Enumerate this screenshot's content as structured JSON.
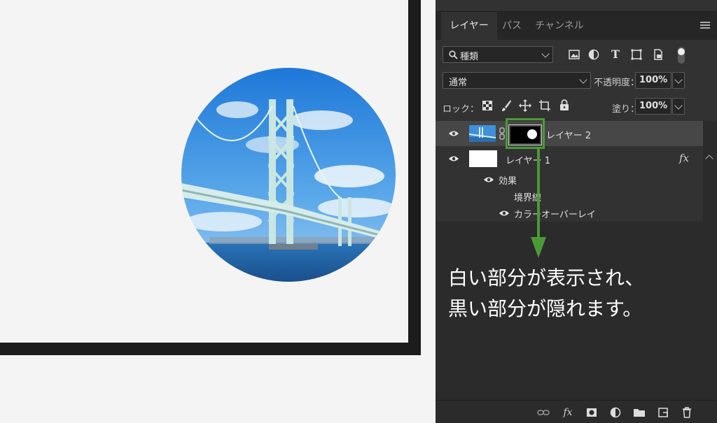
{
  "tabs": [
    {
      "label": "レイヤー"
    },
    {
      "label": "パス"
    },
    {
      "label": "チャンネル"
    }
  ],
  "filter": {
    "kind_label": "種類"
  },
  "blend": {
    "mode": "通常",
    "opacity_label": "不透明度：",
    "opacity_value": "100%"
  },
  "lock": {
    "label": "ロック：",
    "fill_label": "塗り：",
    "fill_value": "100%"
  },
  "layers": [
    {
      "name": "レイヤー 2",
      "selected": true
    },
    {
      "name": "レイヤー 1",
      "fx_badge": "fx"
    }
  ],
  "effects": {
    "header": "効果",
    "items": [
      "境界線",
      "カラーオーバーレイ"
    ]
  },
  "annotation": {
    "line1": "白い部分が表示され、",
    "line2": "黒い部分が隠れます。"
  },
  "colors": {
    "annotation_green": "#4a9a36",
    "panel_bg": "#323232",
    "selected_row": "#474747"
  },
  "icons": [
    "eye-icon",
    "search-icon",
    "image-filter-icon",
    "adjustment-filter-icon",
    "type-filter-icon",
    "shape-filter-icon",
    "smart-object-filter-icon",
    "filter-toggle-icon",
    "lock-transparent-icon",
    "lock-paint-icon",
    "lock-position-icon",
    "lock-artboard-icon",
    "lock-all-icon",
    "link-icon",
    "fx-icon",
    "mask-icon",
    "adjustment-icon",
    "folder-icon",
    "new-layer-icon",
    "trash-icon",
    "panel-menu-icon"
  ]
}
